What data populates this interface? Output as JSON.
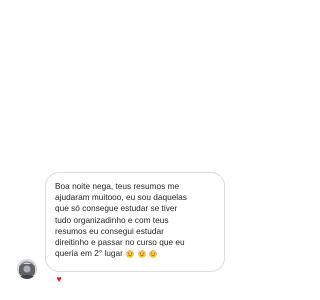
{
  "message": {
    "lines": [
      "Boa noite nega, teus resumos me",
      "ajudaram muitooo, eu sou daquelas",
      "que só consegue estudar se tiver",
      "tudo organizadinho e com teus",
      "resumos eu consegui estudar",
      "direitinho e passar no curso que eu",
      "queria em 2° lugar"
    ],
    "emoji_icons": [
      "smiling-face-with-heart-eyes-icon",
      "smiling-face-with-heart-eyes-icon",
      "smiling-face-with-heart-eyes-icon"
    ]
  },
  "reaction": {
    "glyph": "♥",
    "icon": "heart-icon",
    "color": "#e31b23"
  },
  "avatar": {
    "icon": "profile-avatar-icon"
  }
}
